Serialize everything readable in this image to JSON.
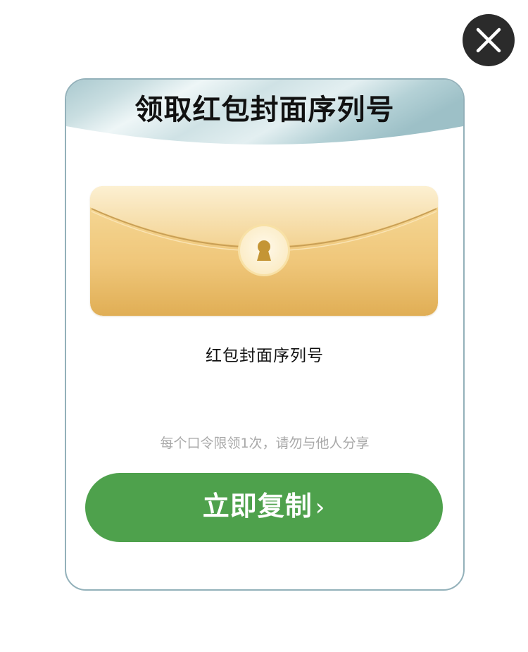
{
  "dialog": {
    "title": "领取红包封面序列号",
    "serial_label": "红包封面序列号",
    "hint": "每个口令限领1次，请勿与他人分享",
    "copy_button": "立即复制",
    "copy_button_chevron": "›"
  },
  "icons": {
    "close": "close-icon",
    "envelope": "envelope-illustration",
    "lock": "keyhole-icon"
  },
  "colors": {
    "button_green": "#4ea14c",
    "card_border": "#93b1ba",
    "envelope_gold": "#e8b862",
    "close_bg": "#2b2b2b"
  }
}
